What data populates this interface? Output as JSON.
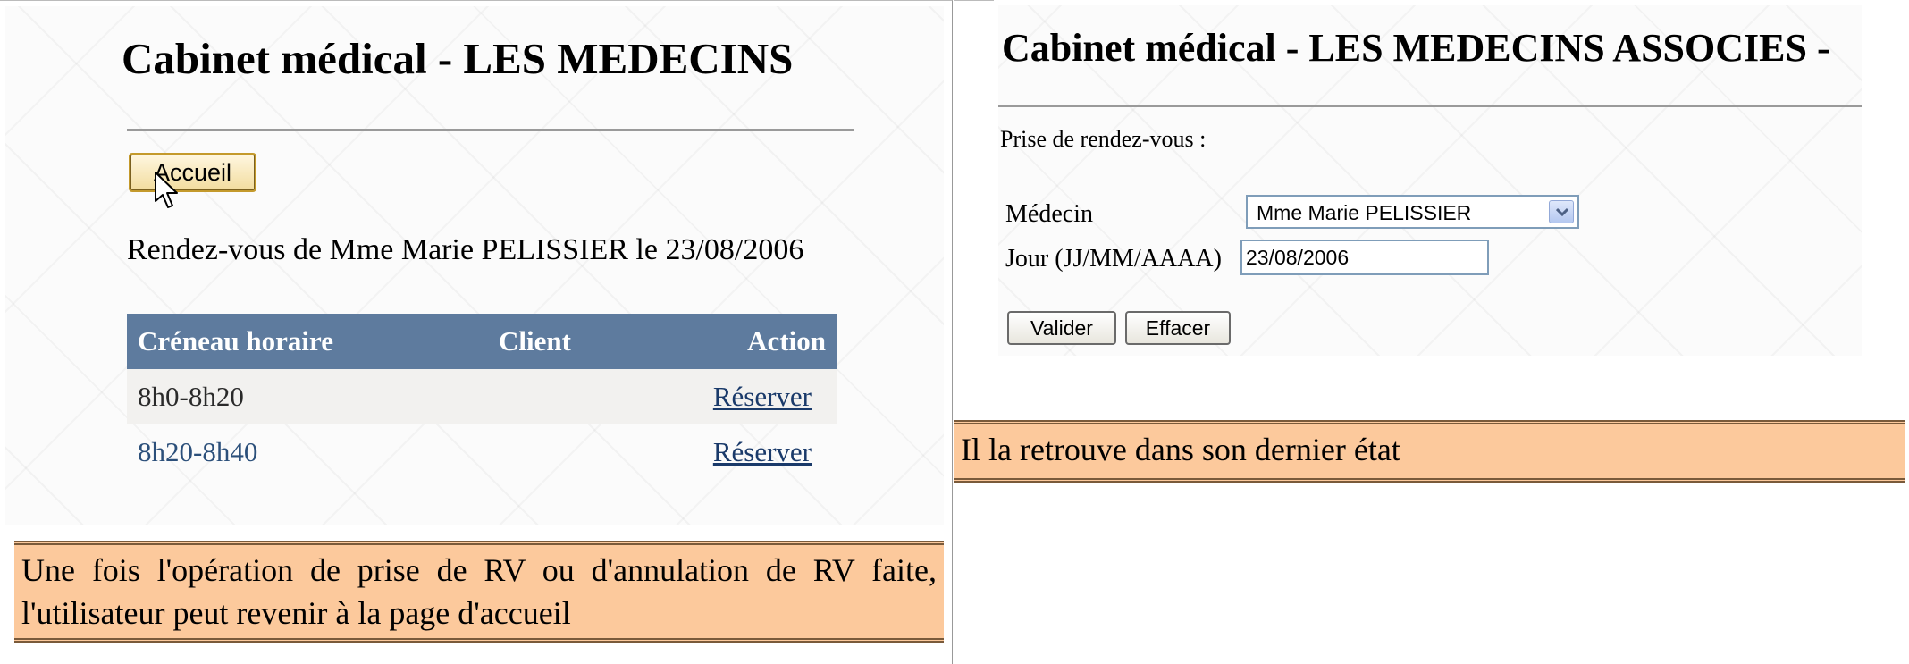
{
  "left": {
    "title": "Cabinet médical - LES MEDECINS",
    "home_button": "Accueil",
    "appointment_heading": "Rendez-vous de Mme Marie PELISSIER le 23/08/2006",
    "table": {
      "headers": [
        "Créneau horaire",
        "Client",
        "Action"
      ],
      "rows": [
        {
          "slot": "8h0-8h20",
          "client": "",
          "action": "Réserver"
        },
        {
          "slot": "8h20-8h40",
          "client": "",
          "action": "Réserver"
        }
      ]
    },
    "caption": "Une fois l'opération de prise de RV ou d'annulation de RV faite, l'utilisateur peut revenir à la page d'accueil"
  },
  "right": {
    "title": "Cabinet médical - LES MEDECINS ASSOCIES -",
    "booking_label": "Prise de rendez-vous :",
    "doctor_label": "Médecin",
    "doctor_selected": "Mme Marie PELISSIER",
    "date_label": "Jour (JJ/MM/AAAA)",
    "date_value": "23/08/2006",
    "validate_button": "Valider",
    "clear_button": "Effacer",
    "caption": "Il la retrouve dans son dernier état"
  },
  "colors": {
    "caption_bg": "#fcc99c",
    "table_header_bg": "#5e7b9e",
    "button_border_focused": "#c49a2c"
  },
  "icons": [
    "mouse-pointer-icon",
    "chevron-down-icon"
  ]
}
